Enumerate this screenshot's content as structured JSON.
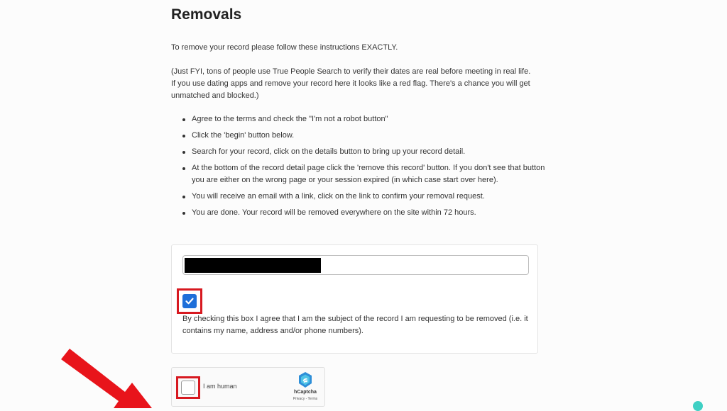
{
  "page": {
    "title": "Removals",
    "intro": "To remove your record please follow these instructions EXACTLY.",
    "note": "(Just FYI, tons of people use True People Search to verify their dates are real before meeting in real life. If you use dating apps and remove your record here it looks like a red flag. There's a chance you will get unmatched and blocked.)",
    "steps": [
      "Agree to the terms and check the \"I'm not a robot button\"",
      "Click the 'begin' button below.",
      "Search for your record, click on the details button to bring up your record detail.",
      "At the bottom of the record detail page click the 'remove this record' button. If you don't see that button you are either on the wrong page or your session expired (in which case start over here).",
      "You will receive an email with a link, click on the link to confirm your removal request.",
      "You are done. Your record will be removed everywhere on the site within 72 hours."
    ]
  },
  "form": {
    "field_value": "",
    "agree_checked": true,
    "agree_text": "By checking this box I agree that I am the subject of the record I am requesting to be removed (i.e. it contains my name, address and/or phone numbers)."
  },
  "captcha": {
    "label": "I am human",
    "brand": "hCaptcha",
    "links": "Privacy - Terms",
    "checked": false
  },
  "colors": {
    "highlight": "#d71920",
    "checkbox": "#1e6fd9",
    "arrow": "#e8141b"
  }
}
